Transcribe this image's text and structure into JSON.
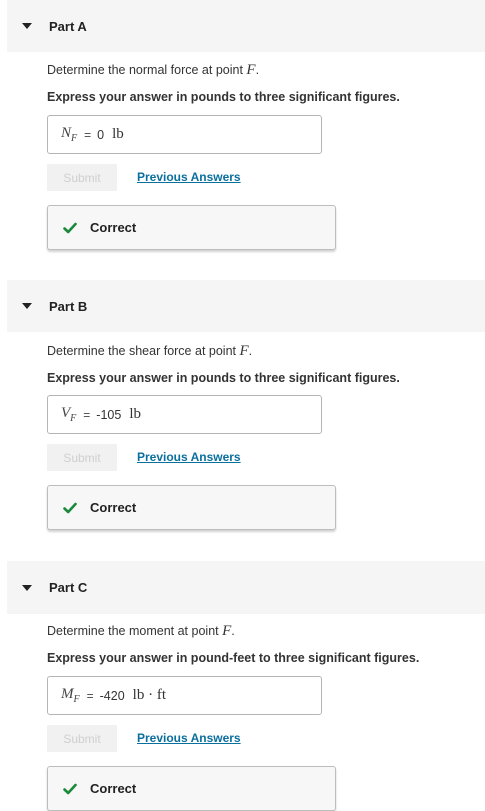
{
  "colors": {
    "accent_link": "#0b6f9e",
    "correct_check": "#1a8a3a"
  },
  "parts": [
    {
      "title": "Part A",
      "prompt_text": "Determine the normal force at point",
      "prompt_var": "F",
      "instruction": "Express your answer in pounds to three significant figures.",
      "symbol": "N",
      "symbol_sub": "F",
      "equals": "=",
      "value": "0",
      "unit": "lb",
      "submit_label": "Submit",
      "previous_answers_label": "Previous Answers",
      "feedback": "Correct",
      "feedback_icon": "checkmark-icon"
    },
    {
      "title": "Part B",
      "prompt_text": "Determine the shear force at point",
      "prompt_var": "F",
      "instruction": "Express your answer in pounds to three significant figures.",
      "symbol": "V",
      "symbol_sub": "F",
      "equals": "=",
      "value": "-105",
      "unit": "lb",
      "submit_label": "Submit",
      "previous_answers_label": "Previous Answers",
      "feedback": "Correct",
      "feedback_icon": "checkmark-icon"
    },
    {
      "title": "Part C",
      "prompt_text": "Determine the moment at point",
      "prompt_var": "F",
      "instruction": "Express your answer in pound-feet to three significant figures.",
      "symbol": "M",
      "symbol_sub": "F",
      "equals": "=",
      "value": "-420",
      "unit": "lb · ft",
      "submit_label": "Submit",
      "previous_answers_label": "Previous Answers",
      "feedback": "Correct",
      "feedback_icon": "checkmark-icon"
    }
  ]
}
